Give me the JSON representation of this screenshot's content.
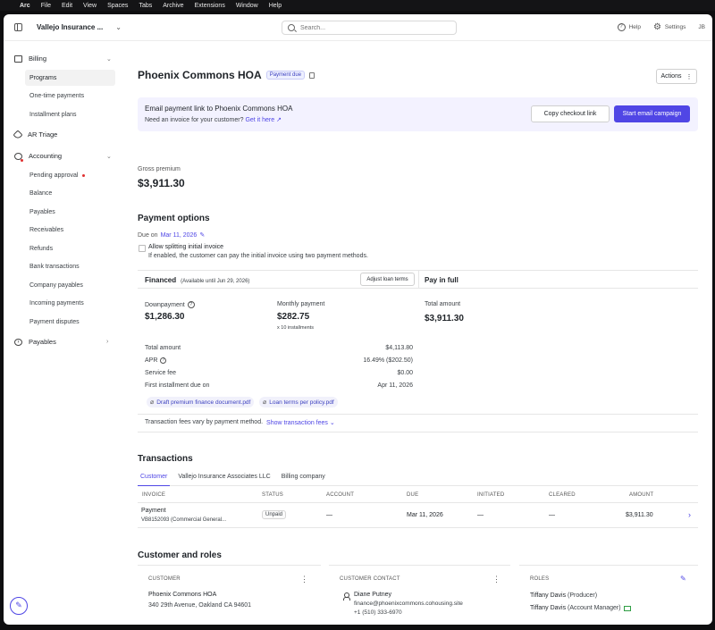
{
  "menubar": {
    "apple": "",
    "app": "Arc",
    "items": [
      "File",
      "Edit",
      "View",
      "Spaces",
      "Tabs",
      "Archive",
      "Extensions",
      "Window",
      "Help"
    ]
  },
  "topbar": {
    "org_name": "Vallejo Insurance ...",
    "search_placeholder": "Search...",
    "help": "Help",
    "settings": "Settings",
    "user_initials": "JB"
  },
  "sidebar": {
    "billing": {
      "label": "Billing",
      "items": [
        "Programs",
        "One-time payments",
        "Installment plans"
      ]
    },
    "ar_triage": "AR Triage",
    "accounting": {
      "label": "Accounting",
      "items": [
        "Pending approval",
        "Balance",
        "Payables",
        "Receivables",
        "Refunds",
        "Bank transactions",
        "Company payables",
        "Incoming payments",
        "Payment disputes"
      ]
    },
    "payables": "Payables"
  },
  "page": {
    "title": "Phoenix Commons HOA",
    "status_badge": "Payment due",
    "actions_button": "Actions"
  },
  "banner": {
    "heading": "Email payment link to Phoenix Commons HOA",
    "subtext": "Need an invoice for your customer?",
    "link": "Get it here ↗",
    "copy_button": "Copy checkout link",
    "campaign_button": "Start email campaign"
  },
  "gross": {
    "label": "Gross premium",
    "value": "$3,911.30"
  },
  "payment_options": {
    "heading": "Payment options",
    "due_label": "Due on",
    "due_date": "Mar 11, 2026",
    "split_label": "Allow splitting initial invoice",
    "split_desc": "If enabled, the customer can pay the initial invoice using two payment methods.",
    "financed": {
      "label": "Financed",
      "availability": "(Available until Jun 29, 2026)",
      "adjust_button": "Adjust loan terms",
      "downpayment_label": "Downpayment",
      "downpayment_value": "$1,286.30",
      "monthly_label": "Monthly payment",
      "monthly_value": "$282.75",
      "installments": "x 10 installments",
      "rows": [
        {
          "label": "Total amount",
          "value": "$4,113.80"
        },
        {
          "label": "APR",
          "value": "16.49% ($202.50)"
        },
        {
          "label": "Service fee",
          "value": "$0.00"
        },
        {
          "label": "First installment due on",
          "value": "Apr 11, 2026"
        }
      ],
      "docs": [
        "Draft premium finance document.pdf",
        "Loan terms per policy.pdf"
      ]
    },
    "pay_in_full": {
      "label": "Pay in full",
      "total_label": "Total amount",
      "total_value": "$3,911.30"
    },
    "fees_note": "Transaction fees vary by payment method.",
    "fees_link": "Show transaction fees"
  },
  "transactions": {
    "heading": "Transactions",
    "tabs": [
      "Customer",
      "Vallejo Insurance Associates LLC",
      "Billing company"
    ],
    "columns": [
      "INVOICE",
      "STATUS",
      "ACCOUNT",
      "DUE",
      "INITIATED",
      "CLEARED",
      "AMOUNT"
    ],
    "rows": [
      {
        "invoice": "Payment",
        "invoice_sub": "VB8152093 (Commercial General...",
        "status": "Unpaid",
        "account": "—",
        "due": "Mar 11, 2026",
        "initiated": "—",
        "cleared": "—",
        "amount": "$3,911.30"
      }
    ]
  },
  "customer_roles": {
    "heading": "Customer and roles",
    "customer": {
      "label": "CUSTOMER",
      "name": "Phoenix Commons HOA",
      "address": "340 29th Avenue, Oakland CA 94601"
    },
    "contact": {
      "label": "CUSTOMER CONTACT",
      "name": "Diane Putney",
      "email": "finance@phoenixcommons.cohousing.site",
      "phone": "+1 (510) 333-6970"
    },
    "roles": {
      "label": "ROLES",
      "items": [
        {
          "name": "Tiffany Davis",
          "role": "(Producer)"
        },
        {
          "name": "Tiffany Davis",
          "role": "(Account Manager)"
        }
      ]
    }
  }
}
